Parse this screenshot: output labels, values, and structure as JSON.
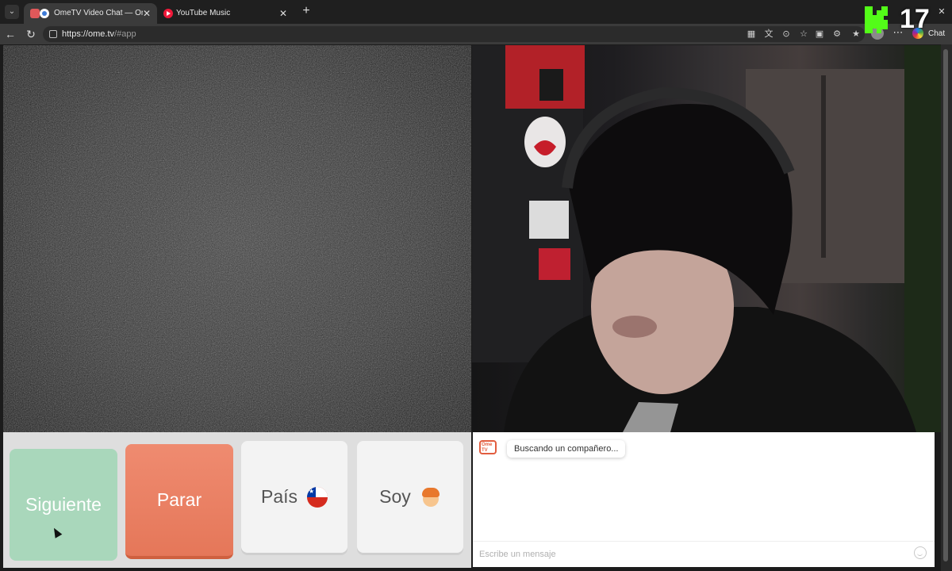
{
  "browser": {
    "tabs": [
      {
        "title": "OmeTV Video Chat — Omegle",
        "active": true
      },
      {
        "title": "YouTube Music",
        "active": false
      }
    ],
    "url_host": "https://ome.tv",
    "url_path": "/#app",
    "chat_label": "Chat",
    "accent_color": "#3b3b3b"
  },
  "overlay": {
    "stream_number": "17",
    "logo_color": "#53fc18"
  },
  "controls": {
    "next_label": "Siguiente",
    "stop_label": "Parar",
    "country_label": "País",
    "country_flag": "chile-flag-icon",
    "gender_label": "Soy",
    "gender_icon": "boy-icon",
    "colors": {
      "next": "#a9d7bb",
      "stop": "#e57759",
      "neutral": "#f3f3f3"
    }
  },
  "chat": {
    "status_message": "Buscando un compañero...",
    "input_placeholder": "Escribe un mensaje",
    "brand_icon": "ometv-icon"
  }
}
